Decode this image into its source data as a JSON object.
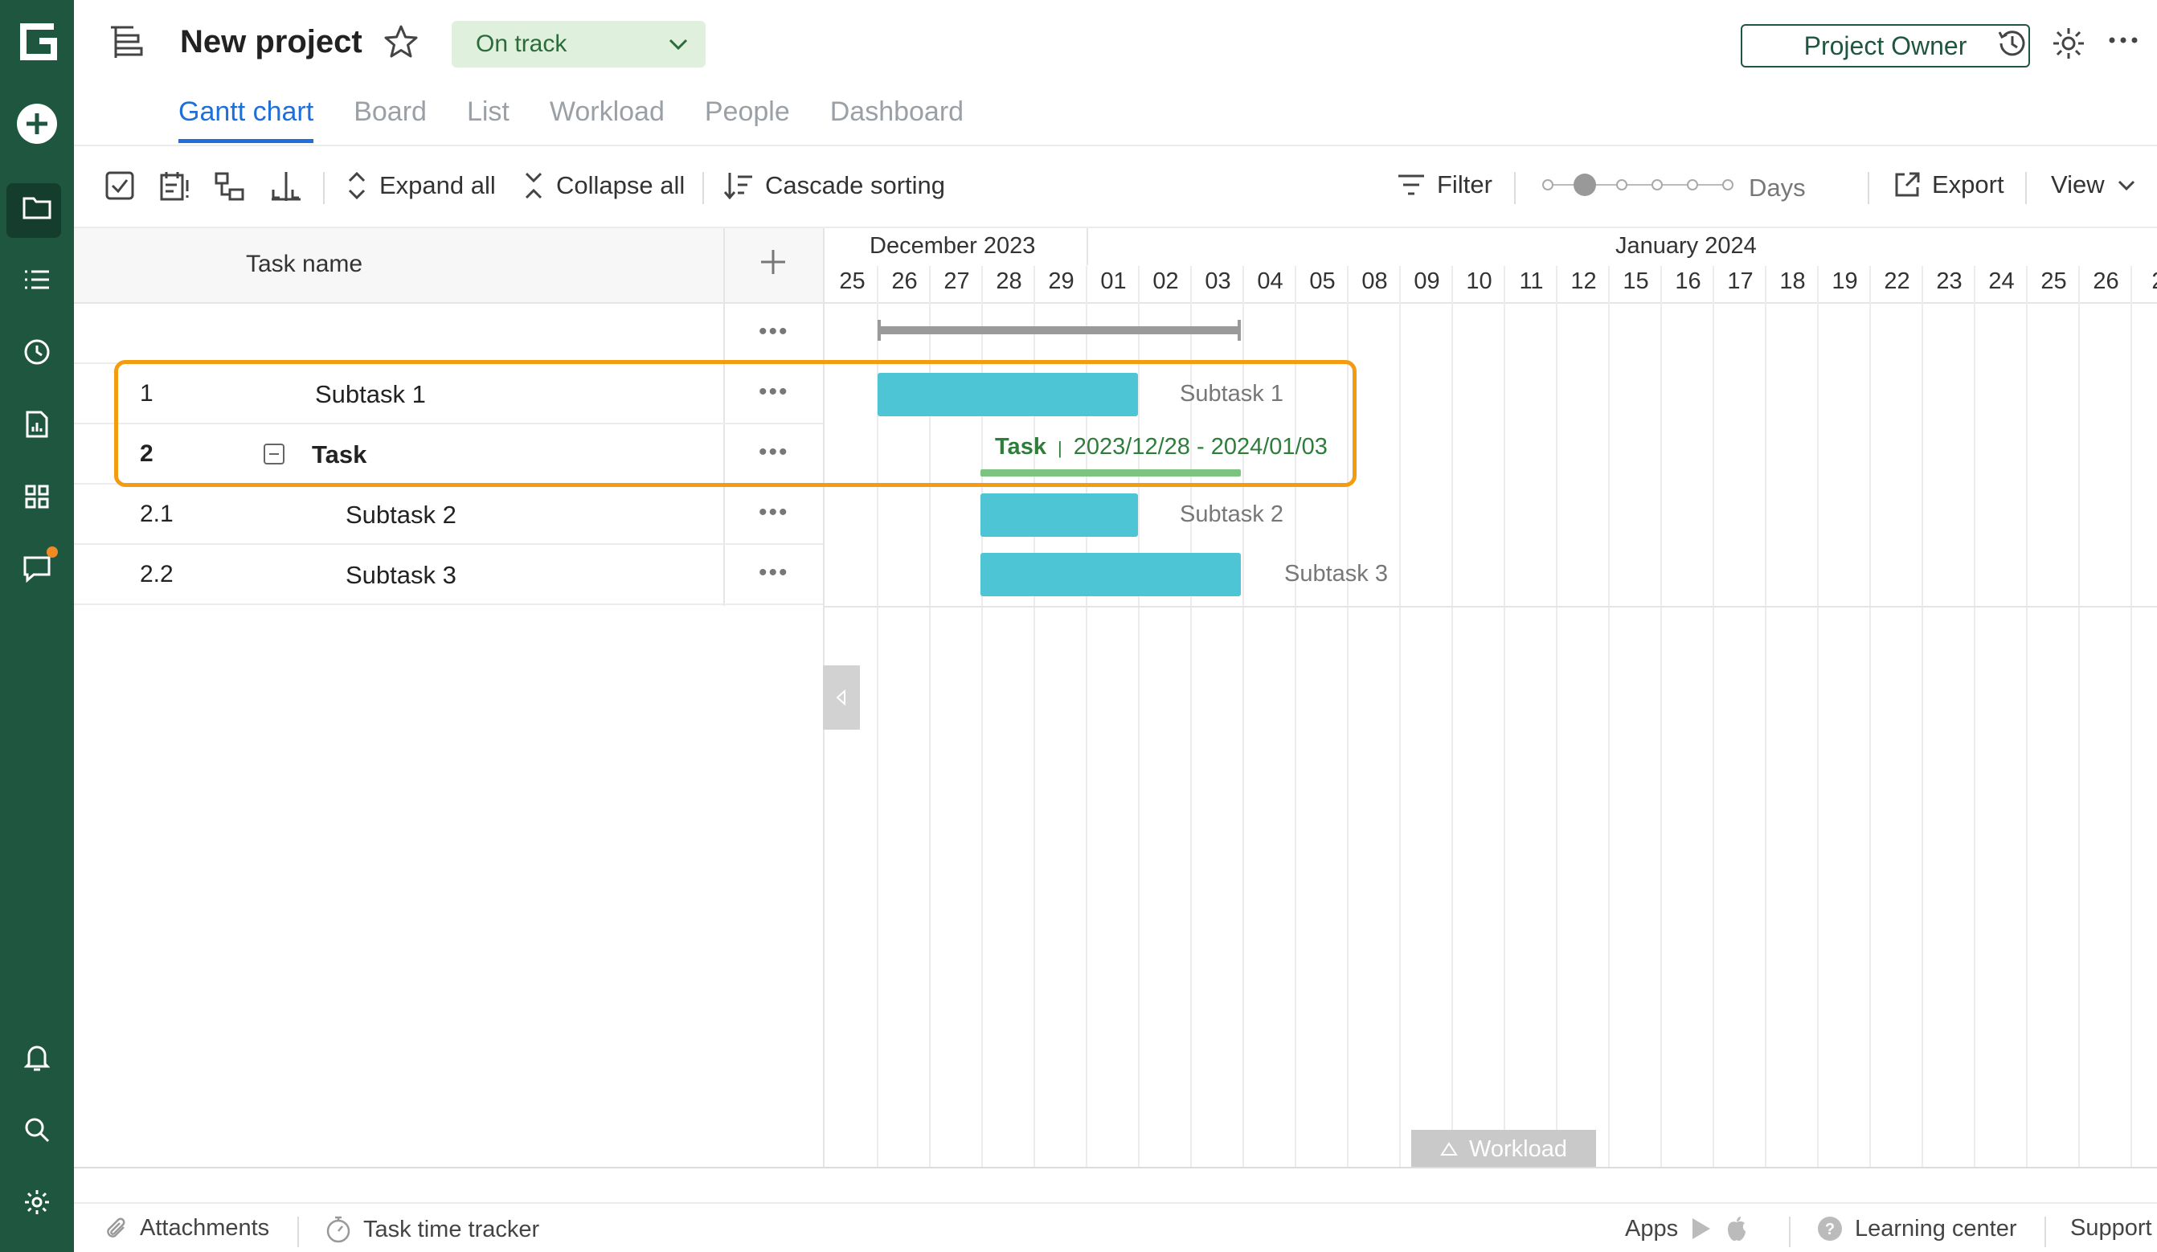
{
  "app": {
    "logo_letter": "G",
    "brand_color": "#1f5640",
    "accent_color": "#1e6fd9",
    "rail_icons": [
      "add-icon",
      "folder-icon",
      "list-icon",
      "clock-icon",
      "report-icon",
      "apps-icon",
      "chat-icon",
      "bell-icon",
      "search-icon",
      "gear-icon"
    ]
  },
  "header": {
    "project_title": "New project",
    "status": "On track",
    "owner_label": "Project Owner"
  },
  "tabs": [
    {
      "label": "Gantt chart",
      "active": true
    },
    {
      "label": "Board",
      "active": false
    },
    {
      "label": "List",
      "active": false
    },
    {
      "label": "Workload",
      "active": false
    },
    {
      "label": "People",
      "active": false
    },
    {
      "label": "Dashboard",
      "active": false
    }
  ],
  "toolbar": {
    "expand_all": "Expand all",
    "collapse_all": "Collapse all",
    "cascade_sorting": "Cascade sorting",
    "filter": "Filter",
    "zoom_label": "Days",
    "export": "Export",
    "view": "View"
  },
  "grid": {
    "column_task_name": "Task name",
    "rows": [
      {
        "num": "",
        "name": ""
      },
      {
        "num": "1",
        "name": "Subtask 1"
      },
      {
        "num": "2",
        "name": "Task"
      },
      {
        "num": "2.1",
        "name": "Subtask 2"
      },
      {
        "num": "2.2",
        "name": "Subtask 3"
      }
    ]
  },
  "timeline": {
    "months": [
      "December 2023",
      "January 2024"
    ],
    "days": [
      "25",
      "26",
      "27",
      "28",
      "29",
      "01",
      "02",
      "03",
      "04",
      "05",
      "08",
      "09",
      "10",
      "11",
      "12",
      "15",
      "16",
      "17",
      "18",
      "19",
      "22",
      "23",
      "24",
      "25",
      "26",
      "2"
    ]
  },
  "bars": {
    "subtask1": "Subtask 1",
    "task_name": "Task",
    "task_range": "2023/12/28 - 2024/01/03",
    "subtask2": "Subtask 2",
    "subtask3": "Subtask 3"
  },
  "workload_label": "Workload",
  "footer": {
    "attachments": "Attachments",
    "time_tracker": "Task time tracker",
    "apps": "Apps",
    "learning_center": "Learning center",
    "support": "Support"
  }
}
